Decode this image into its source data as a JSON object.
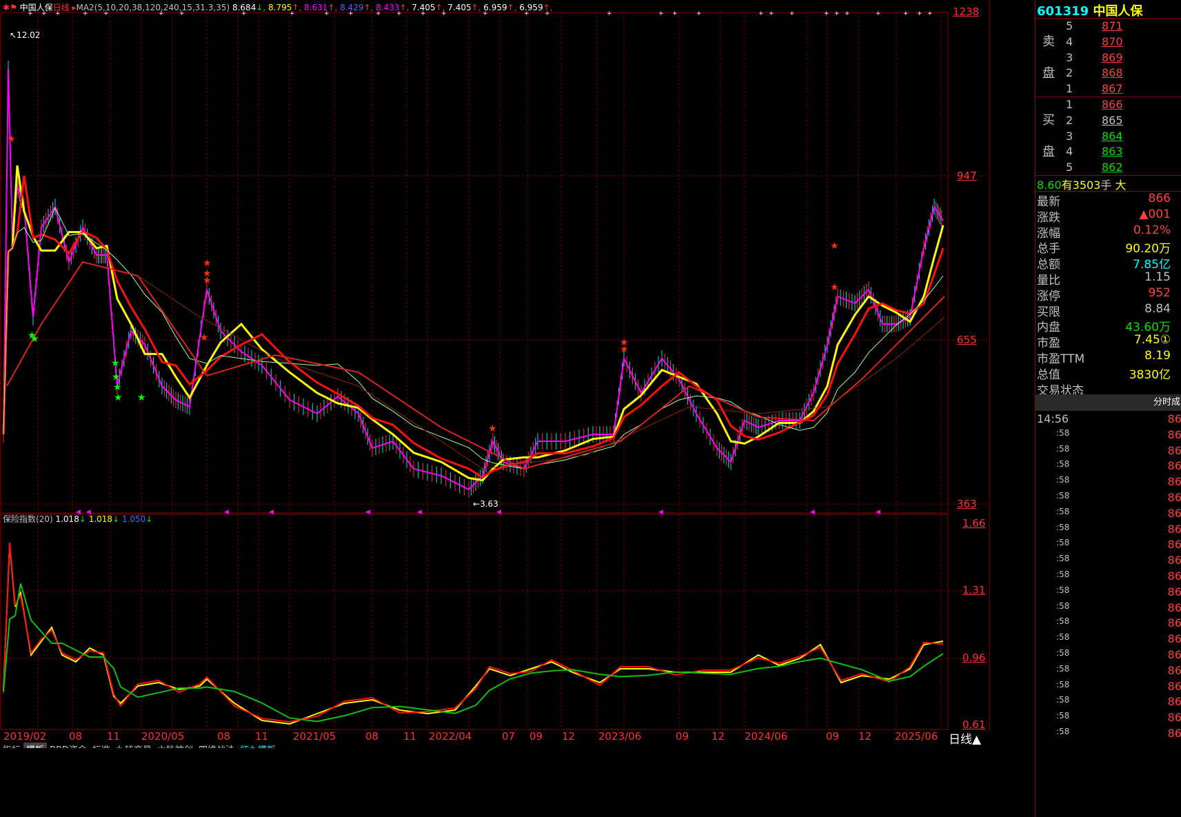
{
  "top_legend": {
    "name": "中国人保",
    "period": "日线",
    "ma_label": "MA2(5,10,20,38,120,240,15,31.3,35)",
    "values": [
      "8.684",
      "8.795",
      "8.631",
      "8.429",
      "8.433",
      "7.405",
      "7.405",
      "6.959",
      "6.959"
    ],
    "arrows": [
      "↓",
      "↑",
      "↑",
      "↑",
      "↑",
      "↑",
      "↑",
      "↑",
      "↑"
    ],
    "colors": [
      "#ffffff",
      "#ffff00",
      "#ff00ff",
      "#4a6aff",
      "#ff00ff",
      "#ffffff",
      "#ffffff",
      "#ffffff",
      "#ffffff"
    ]
  },
  "price_axis": {
    "ticks": [
      "1238",
      "947",
      "655",
      "363"
    ]
  },
  "annotations": {
    "max": "12.02",
    "min": "3.63"
  },
  "indicator": {
    "label": "保险指数(20)",
    "values": [
      "1.018",
      "1.018",
      "1.050"
    ],
    "arrows": [
      "↓",
      "↓",
      "↓"
    ],
    "colors": [
      "#ffffff",
      "#ffff00",
      "#4a6aff"
    ],
    "axis": [
      "1.66",
      "1.31",
      "0.96",
      "0.61"
    ]
  },
  "date_axis": [
    "2019/02",
    "08",
    "11",
    "2020/05",
    "08",
    "11",
    "2021/05",
    "08",
    "11",
    "2022/04",
    "07",
    "09",
    "12",
    "2023/06",
    "09",
    "12",
    "2024/06",
    "09",
    "12",
    "2025/06"
  ],
  "period_button": "日线▲",
  "bottom_tabs": [
    "指标",
    "模板",
    "BBD资金",
    "标准",
    "九转交易",
    "六脉神剑",
    "四维战法",
    "红九模板"
  ],
  "quote": {
    "code": "601319",
    "name": "中国人保",
    "sell_label": [
      "卖",
      "盘"
    ],
    "buy_label": [
      "买",
      "盘"
    ],
    "sell": [
      {
        "lvl": "5",
        "price": "871"
      },
      {
        "lvl": "4",
        "price": "870"
      },
      {
        "lvl": "3",
        "price": "869"
      },
      {
        "lvl": "2",
        "price": "868"
      },
      {
        "lvl": "1",
        "price": "867"
      }
    ],
    "buy": [
      {
        "lvl": "1",
        "price": "866"
      },
      {
        "lvl": "2",
        "price": "865"
      },
      {
        "lvl": "3",
        "price": "864"
      },
      {
        "lvl": "4",
        "price": "863"
      },
      {
        "lvl": "5",
        "price": "862"
      }
    ],
    "banner": {
      "price": "8.60",
      "word": "有",
      "qty": "3503",
      "unit": "手",
      "tail": "大"
    },
    "stats": [
      {
        "label": "最新",
        "value": "866",
        "color": "#ff4040"
      },
      {
        "label": "涨跌",
        "value": "▲001",
        "color": "#ff4040"
      },
      {
        "label": "涨幅",
        "value": "0.12%",
        "color": "#ff4040"
      },
      {
        "label": "总手",
        "value": "90.20万",
        "color": "#ffff00"
      },
      {
        "label": "总额",
        "value": "7.85亿",
        "color": "#00ffff"
      },
      {
        "label": "量比",
        "value": "1.15",
        "color": "#c0c0c0"
      },
      {
        "label": "涨停",
        "value": "952",
        "color": "#ff4040"
      },
      {
        "label": "买限",
        "value": "8.84",
        "color": "#c0c0c0"
      },
      {
        "label": "内盘",
        "value": "43.60万",
        "color": "#00e000"
      },
      {
        "label": "市盈",
        "value": "7.45①",
        "color": "#ffff00"
      },
      {
        "label": "市盈TTM",
        "value": "8.19",
        "color": "#ffff00"
      },
      {
        "label": "总值",
        "value": "3830亿",
        "color": "#ffff00"
      },
      {
        "label": "交易状态",
        "value": "",
        "color": "#c0c0c0"
      }
    ],
    "tick_header": "分时成",
    "ticks_first_time": "14:56",
    "ticks_time": ":58",
    "ticks_price": "86"
  }
}
